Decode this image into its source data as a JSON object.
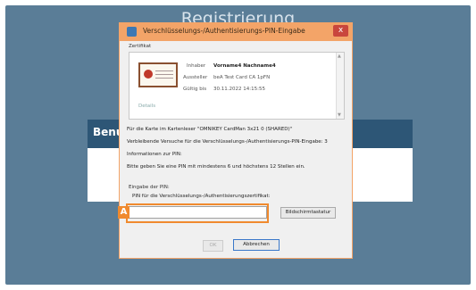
{
  "background": {
    "title": "Registrierung",
    "panel_label": "Benu"
  },
  "dialog": {
    "title": "Verschlüsselungs-/Authentisierungs-PIN-Eingabe",
    "close_glyph": "x",
    "certificate_group_label": "Zertifikat",
    "certificate": {
      "owner_label": "Inhaber",
      "owner_value": "Vorname4 Nachname4",
      "issuer_label": "Aussteller",
      "issuer_value": "beA Test Card CA 1pFN",
      "valid_label": "Gültig bis",
      "valid_value": "30.11.2022 14:15:55",
      "details_label": "Details"
    },
    "info_lines": [
      "Für die Karte im Kartenleser \"OMNIKEY CardMan 3x21 0 (SHARED)\"",
      "Verbleibende Versuche für die Verschlüsselungs-/Authentisierungs-PIN-Eingabe: 3",
      "Informationen zur PIN:",
      "Bitte geben Sie eine PIN mit mindestens 6 und höchstens 12 Stellen ein."
    ],
    "pin_group_label": "Eingabe der PIN:",
    "pin_prompt": "PIN für die Verschlüsselungs-/Authentisierungszertifikat:",
    "pin_value": "",
    "keyboard_button": "Bildschirmtastatur",
    "ok_button": "OK",
    "cancel_button": "Abbrechen"
  },
  "annotation": {
    "badge": "A"
  },
  "colors": {
    "background": "#5a7d97",
    "titlebar": "#f3a468",
    "highlight": "#f08a2e"
  }
}
